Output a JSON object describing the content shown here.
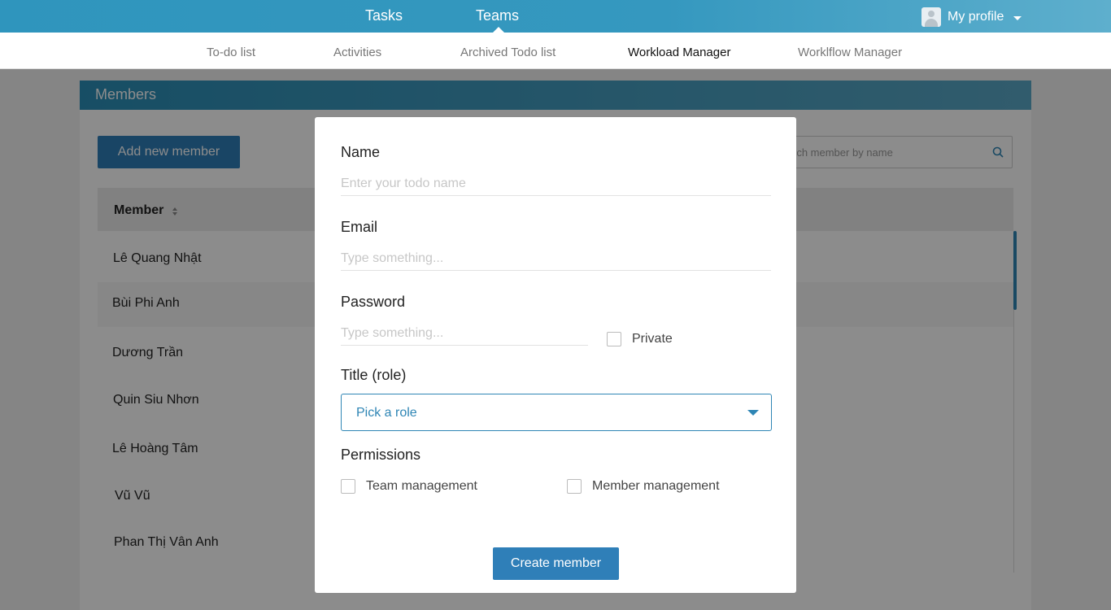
{
  "topbar": {
    "tasks_label": "Tasks",
    "teams_label": "Teams",
    "profile_label": "My profile"
  },
  "subnav": {
    "items": [
      {
        "label": "To-do list"
      },
      {
        "label": "Activities"
      },
      {
        "label": "Archived Todo list"
      },
      {
        "label": "Workload Manager"
      },
      {
        "label": "Worklflow Manager"
      }
    ]
  },
  "members": {
    "header": "Members",
    "add_button": "Add new member",
    "search_placeholder": "rch member by name",
    "column_member": "Member",
    "rows": [
      "Lê Quang Nhật",
      "Bùi Phi Anh",
      "Dương Trần",
      "Quin Siu Nhơn",
      "Lê Hoàng Tâm",
      "Vũ Vũ",
      "Phan Thị Vân Anh"
    ]
  },
  "modal": {
    "name_label": "Name",
    "name_placeholder": "Enter your todo name",
    "email_label": "Email",
    "email_placeholder": "Type something...",
    "password_label": "Password",
    "password_placeholder": "Type something...",
    "private_label": "Private",
    "role_label": "Title (role)",
    "role_value": "Pick a role",
    "permissions_label": "Permissions",
    "perm_team": "Team management",
    "perm_member": "Member management",
    "create_button": "Create member"
  },
  "colors": {
    "accent": "#2f86b5",
    "topbar": "#3598bf"
  }
}
